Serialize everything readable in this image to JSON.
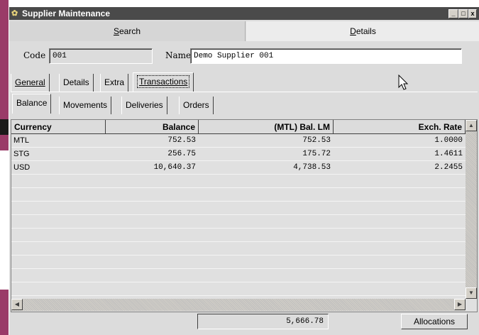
{
  "window": {
    "title": "Supplier Maintenance",
    "controls": [
      "_",
      "□",
      "x"
    ]
  },
  "main_tabs": [
    {
      "label": "Search",
      "mnemonic_index": 0
    },
    {
      "label": "Details",
      "mnemonic_index": 0
    }
  ],
  "fields": {
    "code_label": "Code",
    "code_value": "001",
    "name_label": "Name",
    "name_value": "Demo Supplier 001"
  },
  "section_tabs": [
    "General",
    "Details",
    "Extra",
    "Transactions"
  ],
  "sub_tabs": [
    "Balance",
    "Movements",
    "Deliveries",
    "Orders"
  ],
  "grid": {
    "columns": [
      "Currency",
      "Balance",
      "(MTL) Bal. LM",
      "Exch. Rate"
    ],
    "rows": [
      [
        "MTL",
        "752.53",
        "752.53",
        "1.0000"
      ],
      [
        "STG",
        "256.75",
        "175.72",
        "1.4611"
      ],
      [
        "USD",
        "10,640.37",
        "4,738.53",
        "2.2455"
      ]
    ]
  },
  "footer": {
    "total": "5,666.78",
    "allocations_label": "Allocations"
  }
}
